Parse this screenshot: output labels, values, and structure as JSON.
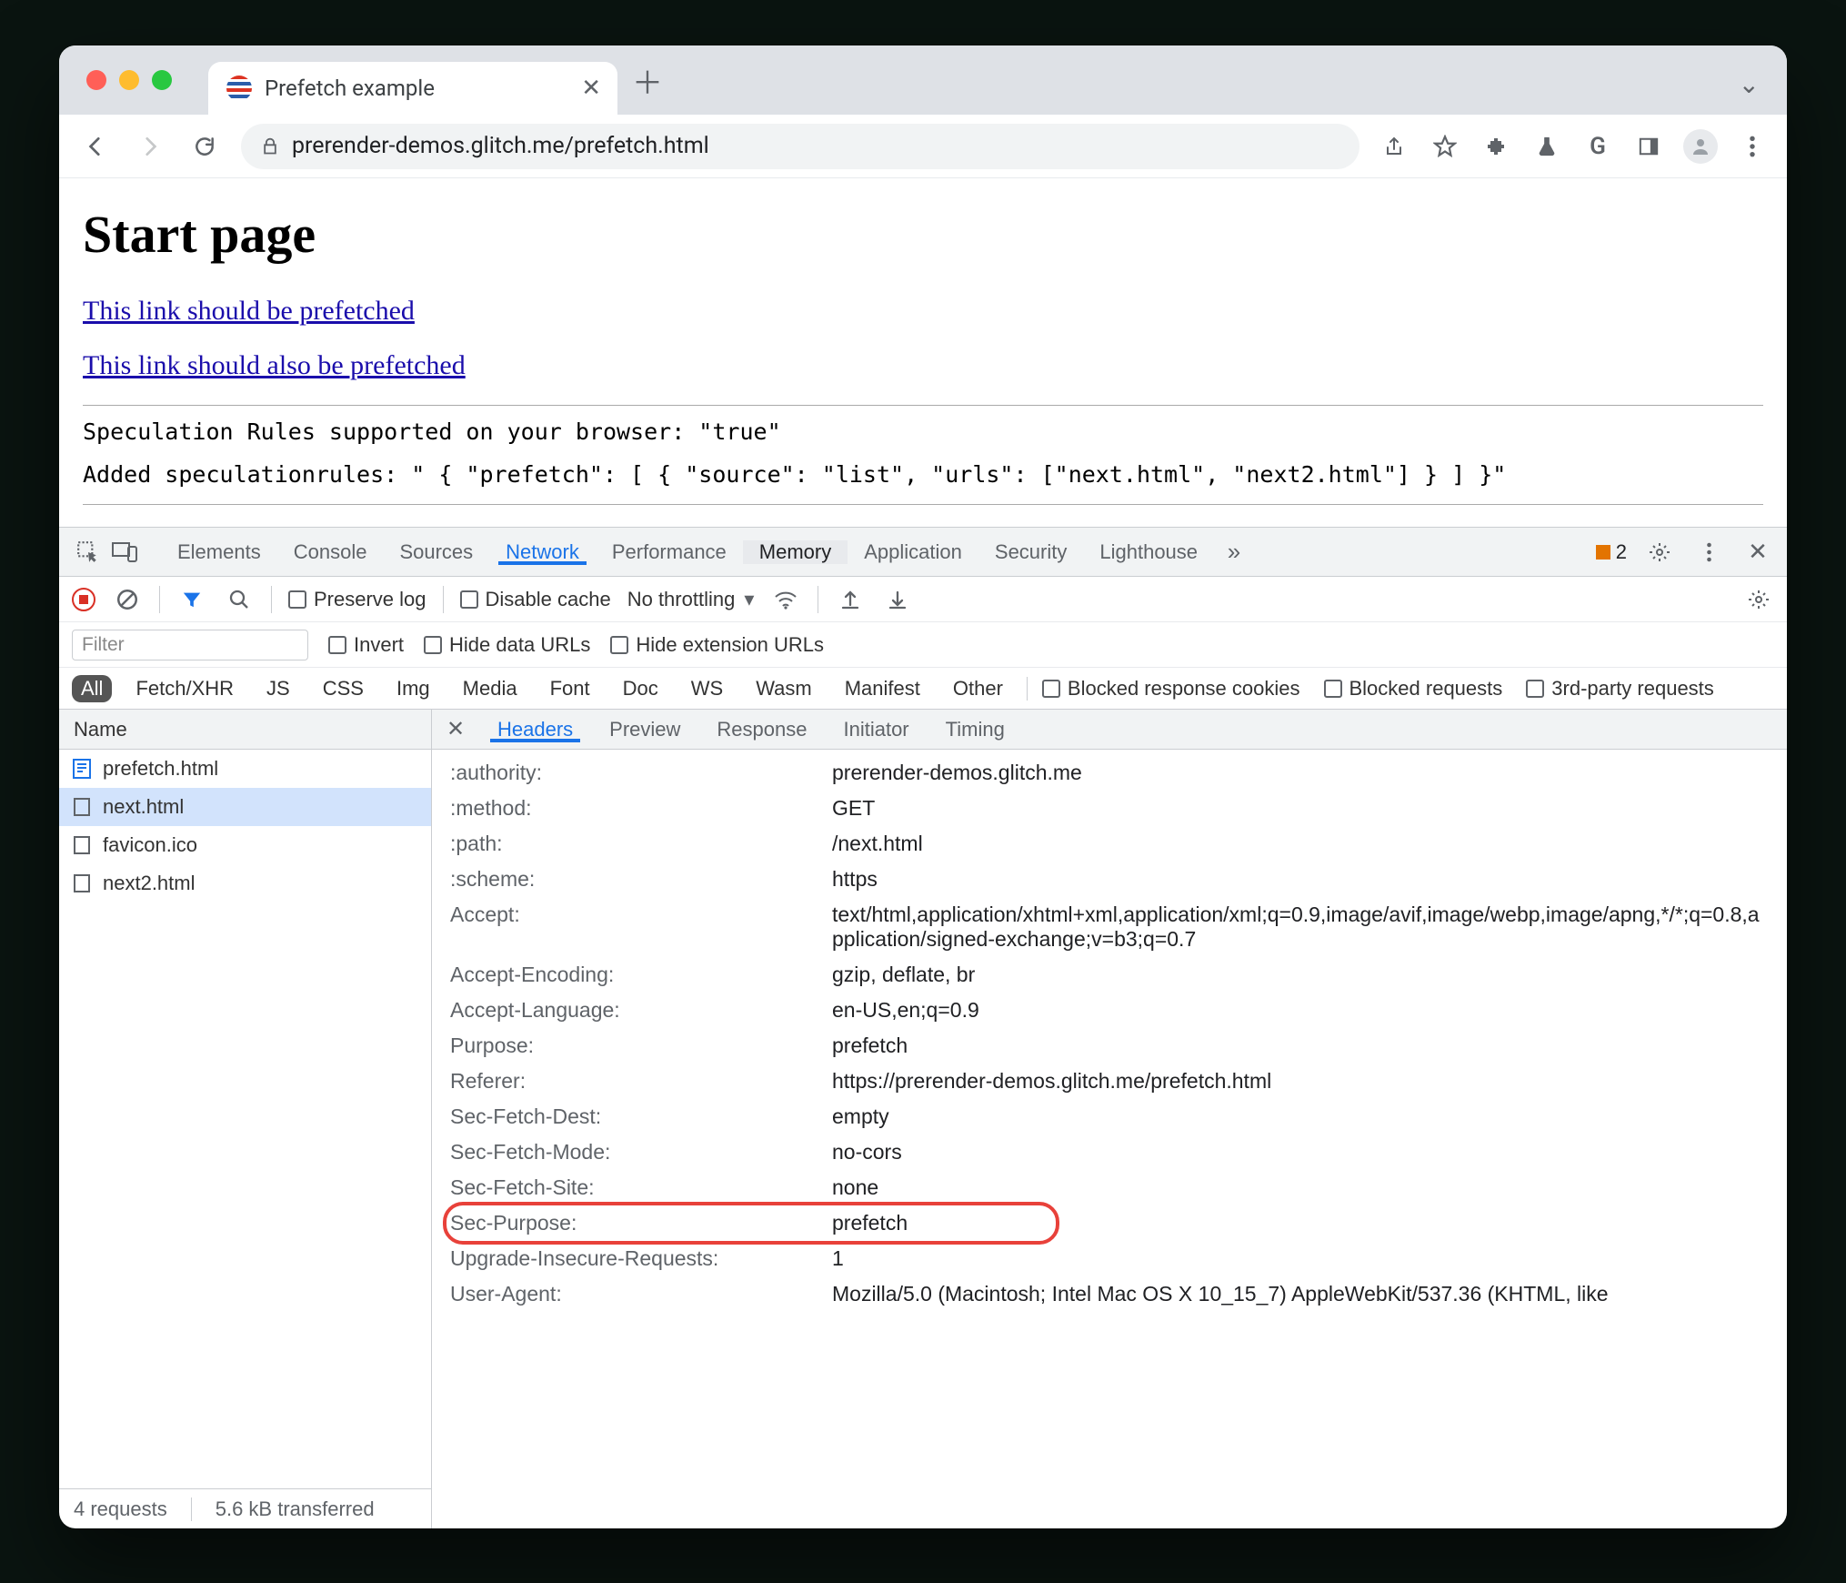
{
  "tab": {
    "title": "Prefetch example"
  },
  "omnibox": {
    "url": "prerender-demos.glitch.me/prefetch.html"
  },
  "page": {
    "heading": "Start page",
    "link1": "This link should be prefetched",
    "link2": "This link should also be prefetched",
    "spec_line": "Speculation Rules supported on your browser: \"true\"",
    "added_line": "Added speculationrules: \" { \"prefetch\": [ { \"source\": \"list\", \"urls\": [\"next.html\", \"next2.html\"] } ] }\""
  },
  "devtools": {
    "tabs": [
      "Elements",
      "Console",
      "Sources",
      "Network",
      "Performance",
      "Memory",
      "Application",
      "Security",
      "Lighthouse"
    ],
    "active": "Network",
    "hover": "Memory",
    "warn_count": "2",
    "filter_placeholder": "Filter",
    "preserve_log": "Preserve log",
    "disable_cache": "Disable cache",
    "throttling": "No throttling",
    "invert": "Invert",
    "hide_data": "Hide data URLs",
    "hide_ext": "Hide extension URLs",
    "types": [
      "All",
      "Fetch/XHR",
      "JS",
      "CSS",
      "Img",
      "Media",
      "Font",
      "Doc",
      "WS",
      "Wasm",
      "Manifest",
      "Other"
    ],
    "type_checks": [
      "Blocked response cookies",
      "Blocked requests",
      "3rd-party requests"
    ],
    "name_header": "Name",
    "requests": [
      {
        "name": "prefetch.html",
        "type": "doc"
      },
      {
        "name": "next.html",
        "type": "file",
        "selected": true
      },
      {
        "name": "favicon.ico",
        "type": "file"
      },
      {
        "name": "next2.html",
        "type": "file"
      }
    ],
    "detail_tabs": [
      "Headers",
      "Preview",
      "Response",
      "Initiator",
      "Timing"
    ],
    "detail_active": "Headers",
    "headers": [
      {
        "k": ":authority:",
        "v": "prerender-demos.glitch.me"
      },
      {
        "k": ":method:",
        "v": "GET"
      },
      {
        "k": ":path:",
        "v": "/next.html"
      },
      {
        "k": ":scheme:",
        "v": "https"
      },
      {
        "k": "Accept:",
        "v": "text/html,application/xhtml+xml,application/xml;q=0.9,image/avif,image/webp,image/apng,*/*;q=0.8,application/signed-exchange;v=b3;q=0.7"
      },
      {
        "k": "Accept-Encoding:",
        "v": "gzip, deflate, br"
      },
      {
        "k": "Accept-Language:",
        "v": "en-US,en;q=0.9"
      },
      {
        "k": "Purpose:",
        "v": "prefetch"
      },
      {
        "k": "Referer:",
        "v": "https://prerender-demos.glitch.me/prefetch.html"
      },
      {
        "k": "Sec-Fetch-Dest:",
        "v": "empty"
      },
      {
        "k": "Sec-Fetch-Mode:",
        "v": "no-cors"
      },
      {
        "k": "Sec-Fetch-Site:",
        "v": "none"
      },
      {
        "k": "Sec-Purpose:",
        "v": "prefetch",
        "highlight": true
      },
      {
        "k": "Upgrade-Insecure-Requests:",
        "v": "1"
      },
      {
        "k": "User-Agent:",
        "v": "Mozilla/5.0 (Macintosh; Intel Mac OS X 10_15_7) AppleWebKit/537.36 (KHTML, like"
      }
    ],
    "status": {
      "requests": "4 requests",
      "transferred": "5.6 kB transferred"
    }
  }
}
